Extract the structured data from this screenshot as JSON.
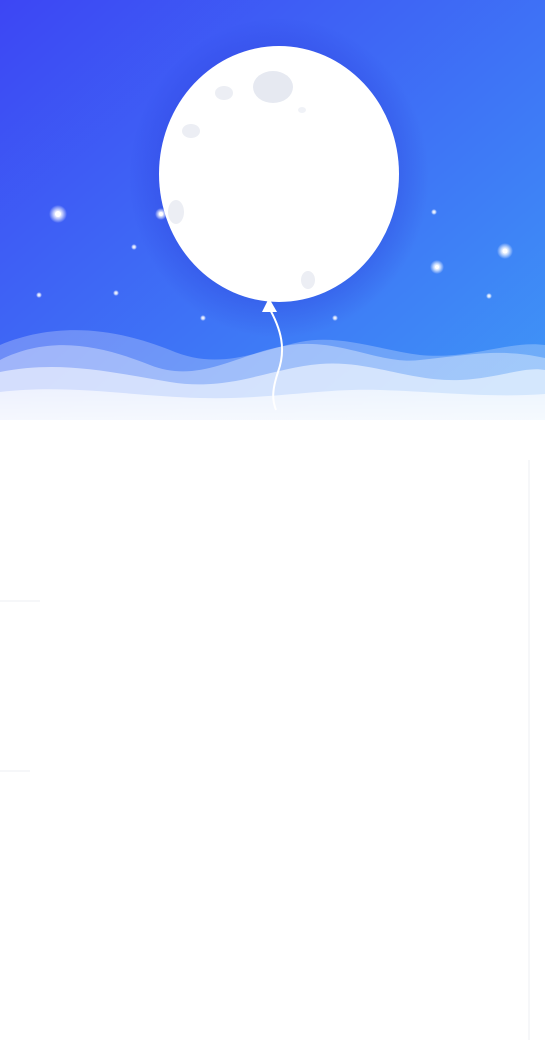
{
  "theme": {
    "sky_top_left": "#3e4cf5",
    "sky_bottom_right": "#3f98f7",
    "balloon": "#ffffff",
    "crater": "#e8ebf2",
    "wave": "#ffffff",
    "background": "#ffffff"
  },
  "hero": {
    "illustration": "moon-balloon-over-clouds",
    "icons": [
      "moon-balloon-icon",
      "star-icon",
      "cloud-wave-icon"
    ]
  }
}
